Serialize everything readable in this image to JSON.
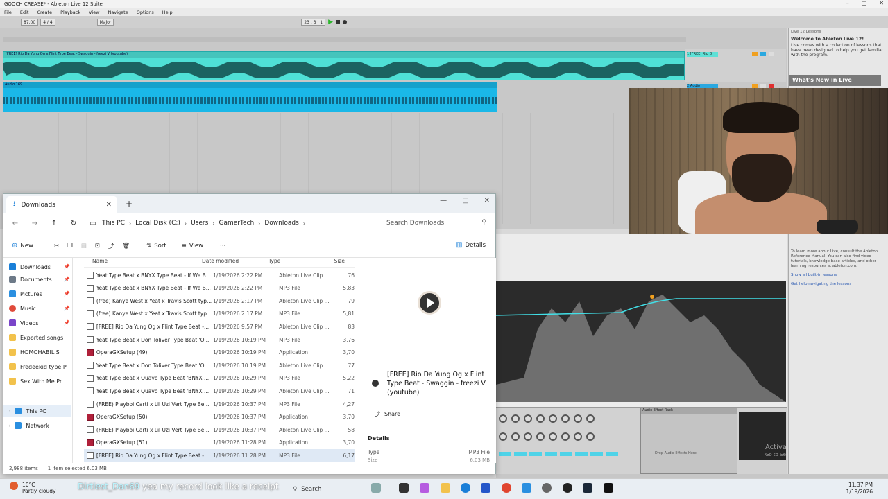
{
  "ableton": {
    "title": "GOOCH CREASE* - Ableton Live 12 Suite",
    "menu": [
      "File",
      "Edit",
      "Create",
      "Playback",
      "View",
      "Navigate",
      "Options",
      "Help"
    ],
    "transport": {
      "tempo": "87.00",
      "sig": "4 / 4",
      "scale": "Major",
      "position": "23 . 3 . 1"
    },
    "tracks": [
      {
        "clip": "[FREE] Rio Da Yung Og x Flint Type Beat - Swaggin - freezi V (youtube)",
        "name": "1 [FREE] Rio D"
      },
      {
        "clip": "Audio 169",
        "name": "2 Audio"
      }
    ],
    "help": {
      "panel_title": "Live 12 Lessons",
      "welcome": "Welcome to Ableton Live 12!",
      "intro": "Live comes with a collection of lessons that have been designed to help you get familiar with the program.",
      "whats_new": "What's New in Live",
      "learn_more": "To learn more about Live, consult the Ableton Reference Manual. You can also find video tutorials, knowledge base articles, and other learning resources at ableton.com.",
      "show_all": "Show all built-in lessons",
      "get_help": "Get help navigating the lessons"
    },
    "device": {
      "rack": "Audio Effect Rack",
      "drop": "Drop Audio Effects Here"
    }
  },
  "explorer": {
    "tab_title": "Downloads",
    "breadcrumbs": [
      "This PC",
      "Local Disk (C:)",
      "Users",
      "GamerTech",
      "Downloads"
    ],
    "search_placeholder": "Search Downloads",
    "toolbar": {
      "new": "New",
      "sort": "Sort",
      "view": "View",
      "more": "···",
      "details": "Details"
    },
    "nav_items": [
      {
        "label": "Downloads",
        "color": "#1a7fd8"
      },
      {
        "label": "Documents",
        "color": "#6d7a88"
      },
      {
        "label": "Pictures",
        "color": "#2a8fe0"
      },
      {
        "label": "Music",
        "color": "#e04a3a"
      },
      {
        "label": "Videos",
        "color": "#7a45c9"
      },
      {
        "label": "Exported songs",
        "color": "#f2c24c"
      },
      {
        "label": "HOMOHABILIS",
        "color": "#f2c24c"
      },
      {
        "label": "Fredeekid type P",
        "color": "#f2c24c"
      },
      {
        "label": "Sex With Me Pr",
        "color": "#f2c24c"
      },
      {
        "label": "This PC",
        "color": "#2a8fe0"
      },
      {
        "label": "Network",
        "color": "#2a8fe0"
      }
    ],
    "columns": {
      "name": "Name",
      "date": "Date modified",
      "type": "Type",
      "size": "Size"
    },
    "files": [
      {
        "name": "Yeat Type Beat x BNYX Type Beat - If We B...",
        "date": "1/19/2026 2:22 PM",
        "type": "Ableton Live Clip ...",
        "size": "76",
        "app": false
      },
      {
        "name": "Yeat Type Beat x BNYX Type Beat - If We B...",
        "date": "1/19/2026 2:22 PM",
        "type": "MP3 File",
        "size": "5,83",
        "app": false
      },
      {
        "name": "(free) Kanye West x Yeat x Travis Scott typ...",
        "date": "1/19/2026 2:17 PM",
        "type": "Ableton Live Clip ...",
        "size": "79",
        "app": false
      },
      {
        "name": "(free) Kanye West x Yeat x Travis Scott typ...",
        "date": "1/19/2026 2:17 PM",
        "type": "MP3 File",
        "size": "5,81",
        "app": false
      },
      {
        "name": "[FREE] Rio Da Yung Og x Flint Type Beat -...",
        "date": "1/19/2026 9:57 PM",
        "type": "Ableton Live Clip ...",
        "size": "83",
        "app": false
      },
      {
        "name": "Yeat Type Beat x Don Toliver Type Beat 'O...",
        "date": "1/19/2026 10:19 PM",
        "type": "MP3 File",
        "size": "3,76",
        "app": false
      },
      {
        "name": "OperaGXSetup (49)",
        "date": "1/19/2026 10:19 PM",
        "type": "Application",
        "size": "3,70",
        "app": true
      },
      {
        "name": "Yeat Type Beat x Don Toliver Type Beat 'O...",
        "date": "1/19/2026 10:19 PM",
        "type": "Ableton Live Clip ...",
        "size": "77",
        "app": false
      },
      {
        "name": "Yeat Type Beat x Quavo Type Beat 'BNYX ...",
        "date": "1/19/2026 10:29 PM",
        "type": "MP3 File",
        "size": "5,22",
        "app": false
      },
      {
        "name": "Yeat Type Beat x Quavo Type Beat 'BNYX ...",
        "date": "1/19/2026 10:29 PM",
        "type": "Ableton Live Clip ...",
        "size": "71",
        "app": false
      },
      {
        "name": "(FREE) Playboi Carti x Lil Uzi Vert Type Be...",
        "date": "1/19/2026 10:37 PM",
        "type": "MP3 File",
        "size": "4,27",
        "app": false
      },
      {
        "name": "OperaGXSetup (50)",
        "date": "1/19/2026 10:37 PM",
        "type": "Application",
        "size": "3,70",
        "app": true
      },
      {
        "name": "(FREE) Playboi Carti x Lil Uzi Vert Type Be...",
        "date": "1/19/2026 10:37 PM",
        "type": "Ableton Live Clip ...",
        "size": "58",
        "app": false
      },
      {
        "name": "OperaGXSetup (51)",
        "date": "1/19/2026 11:28 PM",
        "type": "Application",
        "size": "3,70",
        "app": true
      },
      {
        "name": "[FREE] Rio Da Yung Og x Flint Type Beat -...",
        "date": "1/19/2026 11:28 PM",
        "type": "MP3 File",
        "size": "6,17",
        "app": false,
        "selected": true
      }
    ],
    "preview": {
      "title": "[FREE] Rio Da Yung Og x Flint Type Beat - Swaggin - freezi V (youtube)",
      "share": "Share",
      "details_label": "Details",
      "type_label": "Type",
      "type_value": "MP3 File",
      "size_label": "Size",
      "size_value": "6.03 MB"
    },
    "status": {
      "count": "2,988 items",
      "selection": "1 item selected  6.03 MB"
    }
  },
  "taskbar": {
    "temp": "10°C",
    "weather": "Partly cloudy",
    "chat_user": "Dirtiest_Dan69",
    "chat_msg": " yea my record look like a receipt",
    "search": "Search",
    "time": "11:37 PM",
    "date": "1/19/2026"
  },
  "watermark": {
    "line1": "Activa",
    "line2": "Go to Se"
  }
}
